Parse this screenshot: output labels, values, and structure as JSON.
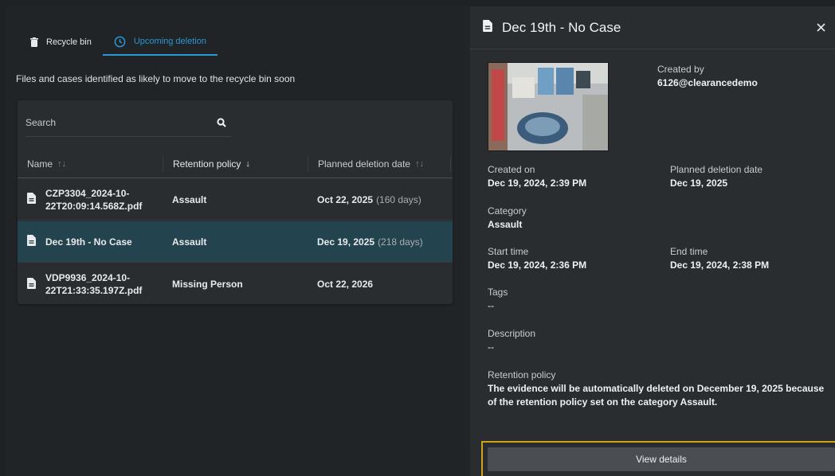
{
  "tabs": [
    {
      "label": "Recycle bin",
      "icon": "trash-icon"
    },
    {
      "label": "Upcoming deletion",
      "icon": "clock-icon"
    }
  ],
  "subtitle": "Files and cases identified as likely to move to the recycle bin soon",
  "search": {
    "placeholder": "Search"
  },
  "columns": [
    {
      "label": "Name",
      "sort": "↑↓"
    },
    {
      "label": "Retention policy",
      "sort": "↓"
    },
    {
      "label": "Planned deletion date",
      "sort": "↑↓"
    }
  ],
  "rows": [
    {
      "name": "CZP3304_2024-10-22T20:09:14.568Z.pdf",
      "policy": "Assault",
      "date": "Oct 22, 2025",
      "days": "(160 days)"
    },
    {
      "name": "Dec 19th - No Case",
      "policy": "Assault",
      "date": "Dec 19, 2025",
      "days": "(218 days)"
    },
    {
      "name": "VDP9936_2024-10-22T21:33:35.197Z.pdf",
      "policy": "Missing Person",
      "date": "Oct 22, 2026",
      "days": ""
    }
  ],
  "panel": {
    "title": "Dec 19th - No Case",
    "created_by_label": "Created by",
    "created_by": "6126@clearancedemo",
    "created_on_label": "Created on",
    "created_on": "Dec 19, 2024, 2:39 PM",
    "planned_label": "Planned deletion date",
    "planned": "Dec 19, 2025",
    "category_label": "Category",
    "category": "Assault",
    "start_label": "Start time",
    "start": "Dec 19, 2024, 2:36 PM",
    "end_label": "End time",
    "end": "Dec 19, 2024, 2:38 PM",
    "tags_label": "Tags",
    "tags": "--",
    "description_label": "Description",
    "description": "--",
    "retention_label": "Retention policy",
    "retention": "The evidence will be automatically deleted on December 19, 2025 because of the retention policy set on the category Assault.",
    "view_details": "View details"
  },
  "colors": {
    "accent": "#2a97d6",
    "selected_row": "#23444f",
    "highlight": "#d4a017"
  }
}
